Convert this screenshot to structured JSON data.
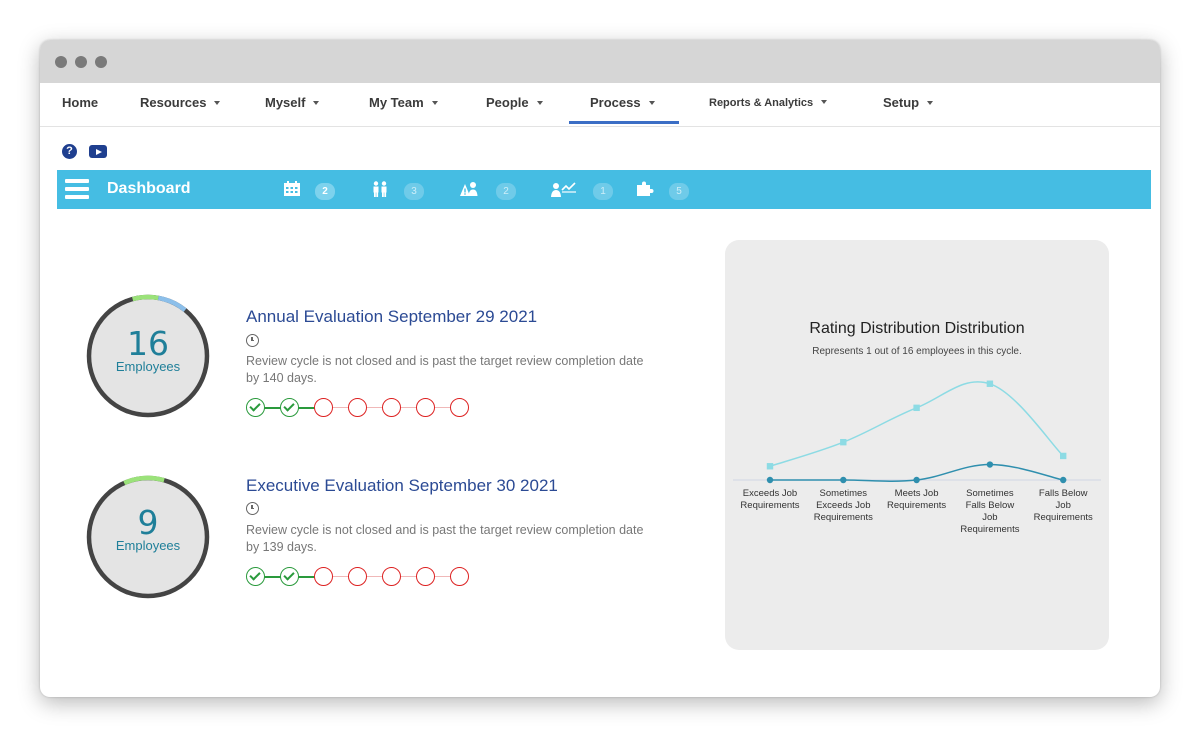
{
  "nav": {
    "items": [
      {
        "label": "Home",
        "caret": false
      },
      {
        "label": "Resources",
        "caret": true
      },
      {
        "label": "Myself",
        "caret": true
      },
      {
        "label": "My Team",
        "caret": true
      },
      {
        "label": "People",
        "caret": true
      },
      {
        "label": "Process",
        "caret": true,
        "active": true
      },
      {
        "label": "Reports & Analytics",
        "caret": true
      },
      {
        "label": "Setup",
        "caret": true
      }
    ]
  },
  "icons": {
    "help": "question-circle-icon",
    "video": "youtube-icon"
  },
  "dashboard": {
    "title": "Dashboard",
    "badges": [
      {
        "icon": "calendar-icon",
        "count": "2",
        "active": true
      },
      {
        "icon": "people-icon",
        "count": "3"
      },
      {
        "icon": "warning-person-icon",
        "count": "2"
      },
      {
        "icon": "person-chart-icon",
        "count": "1"
      },
      {
        "icon": "puzzle-icon",
        "count": "5"
      }
    ]
  },
  "cycles": [
    {
      "count": "16",
      "count_label": "Employees",
      "title": "Annual Evaluation September 29 2021",
      "desc_line1": "Review cycle is not closed and is past the target review completion date",
      "desc_line2": "by 140 days.",
      "steps": [
        "done",
        "done",
        "todo",
        "todo",
        "todo",
        "todo",
        "todo"
      ],
      "ring_green_fraction": 0.07,
      "ring_blue_fraction": 0.08
    },
    {
      "count": "9",
      "count_label": "Employees",
      "title": "Executive Evaluation September 30 2021",
      "desc_line1": "Review cycle is not closed and is past the target review completion date",
      "desc_line2": "by 139 days.",
      "steps": [
        "done",
        "done",
        "todo",
        "todo",
        "todo",
        "todo",
        "todo"
      ],
      "ring_green_fraction": 0.11,
      "ring_blue_fraction": 0
    }
  ],
  "colors": {
    "accent": "#45bde3",
    "link": "#2b4a94",
    "done": "#2a9a3c",
    "todo": "#dd2222",
    "series_light": "#8ddbe4",
    "series_dark": "#2f8fae"
  },
  "chart_data": {
    "type": "line",
    "title": "Rating Distribution Distribution",
    "subtitle": "Represents 1 out of 16 employees in this cycle.",
    "categories": [
      [
        "Exceeds Job",
        "Requirements"
      ],
      [
        "Sometimes",
        "Exceeds Job",
        "Requirements"
      ],
      [
        "Meets Job",
        "Requirements"
      ],
      [
        "Sometimes",
        "Falls Below",
        "Job",
        "Requirements"
      ],
      [
        "Falls Below",
        "Job",
        "Requirements"
      ]
    ],
    "series": [
      {
        "values": [
          0.4,
          1.1,
          2.1,
          2.8,
          0.7
        ]
      },
      {
        "values": [
          0,
          0,
          0,
          0.45,
          0
        ]
      }
    ],
    "ylim": [
      0,
      3.2
    ],
    "grid": false,
    "legend": "none"
  }
}
